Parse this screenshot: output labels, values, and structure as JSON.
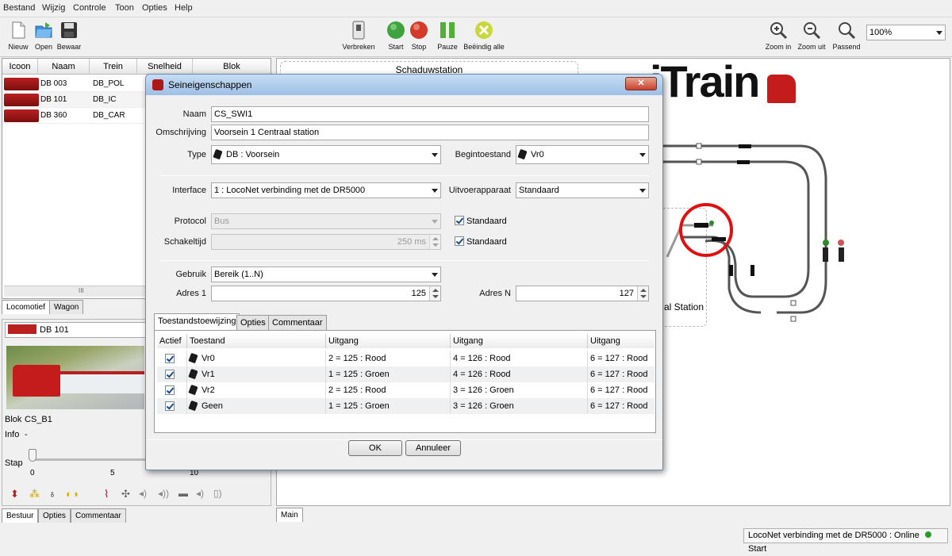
{
  "menu": [
    "Bestand",
    "Wijzig",
    "Controle",
    "Toon",
    "Opties",
    "Help"
  ],
  "toolbar": {
    "new": "Nieuw",
    "open": "Open",
    "save": "Bewaar",
    "disconnect": "Verbreken",
    "start": "Start",
    "stop": "Stop",
    "pause": "Pauze",
    "end_all": "Beëindig alle",
    "zoom_in": "Zoom in",
    "zoom_out": "Zoom uit",
    "fit": "Passend",
    "zoom_value": "100%"
  },
  "loco_table": {
    "headers": [
      "Icoon",
      "Naam",
      "Trein",
      "Snelheid",
      "Blok"
    ],
    "rows": [
      {
        "name": "DB 003",
        "train": "DB_POL"
      },
      {
        "name": "DB 101",
        "train": "DB_IC"
      },
      {
        "name": "DB 360",
        "train": "DB_CAR"
      }
    ],
    "scroll_glyph": "III"
  },
  "left_tabs": [
    "Locomotief",
    "Wagon"
  ],
  "control": {
    "selected_loco": "DB 101",
    "blok_label": "Blok",
    "blok_value": "CS_B1",
    "info_label": "Info",
    "info_value": "-",
    "stap_label": "Stap",
    "ticks": [
      "0",
      "5",
      "10"
    ],
    "tabs": [
      "Bestuur",
      "Opties",
      "Commentaar"
    ]
  },
  "main": {
    "station_label": "Schaduwstation",
    "station_partial": "al Station",
    "logo": "iTrain",
    "tab": "Main"
  },
  "status": {
    "text": "LocoNet verbinding met de DR5000 : Online",
    "start": "Start"
  },
  "dialog": {
    "title": "Seineigenschappen",
    "naam_label": "Naam",
    "naam": "CS_SWI1",
    "omschrijving_label": "Omschrijving",
    "omschrijving": "Voorsein 1 Centraal station",
    "type_label": "Type",
    "type": "DB : Voorsein",
    "begin_label": "Begintoestand",
    "begin": "Vr0",
    "interface_label": "Interface",
    "interface": "1 : LocoNet verbinding met de DR5000",
    "uitvoer_label": "Uitvoerapparaat",
    "uitvoer": "Standaard",
    "protocol_label": "Protocol",
    "protocol": "Bus",
    "schakel_label": "Schakeltijd",
    "schakel": "250 ms",
    "standaard": "Standaard",
    "gebruik_label": "Gebruik",
    "gebruik": "Bereik (1..N)",
    "adres1_label": "Adres 1",
    "adres1": "125",
    "adresn_label": "Adres N",
    "adresn": "127",
    "tabs": [
      "Toestandstoewijzing",
      "Opties",
      "Commentaar"
    ],
    "table_headers": [
      "Actief",
      "Toestand",
      "Uitgang",
      "Uitgang",
      "Uitgang"
    ],
    "rows": [
      {
        "state": "Vr0",
        "o1": "2 = 125 : Rood",
        "o2": "4 = 126 : Rood",
        "o3": "6 = 127 : Rood"
      },
      {
        "state": "Vr1",
        "o1": "1 = 125 : Groen",
        "o2": "4 = 126 : Rood",
        "o3": "6 = 127 : Rood"
      },
      {
        "state": "Vr2",
        "o1": "2 = 125 : Rood",
        "o2": "3 = 126 : Groen",
        "o3": "6 = 127 : Rood"
      },
      {
        "state": "Geen",
        "o1": "1 = 125 : Groen",
        "o2": "3 = 126 : Groen",
        "o3": "6 = 127 : Rood"
      }
    ],
    "ok": "OK",
    "cancel": "Annuleer"
  }
}
